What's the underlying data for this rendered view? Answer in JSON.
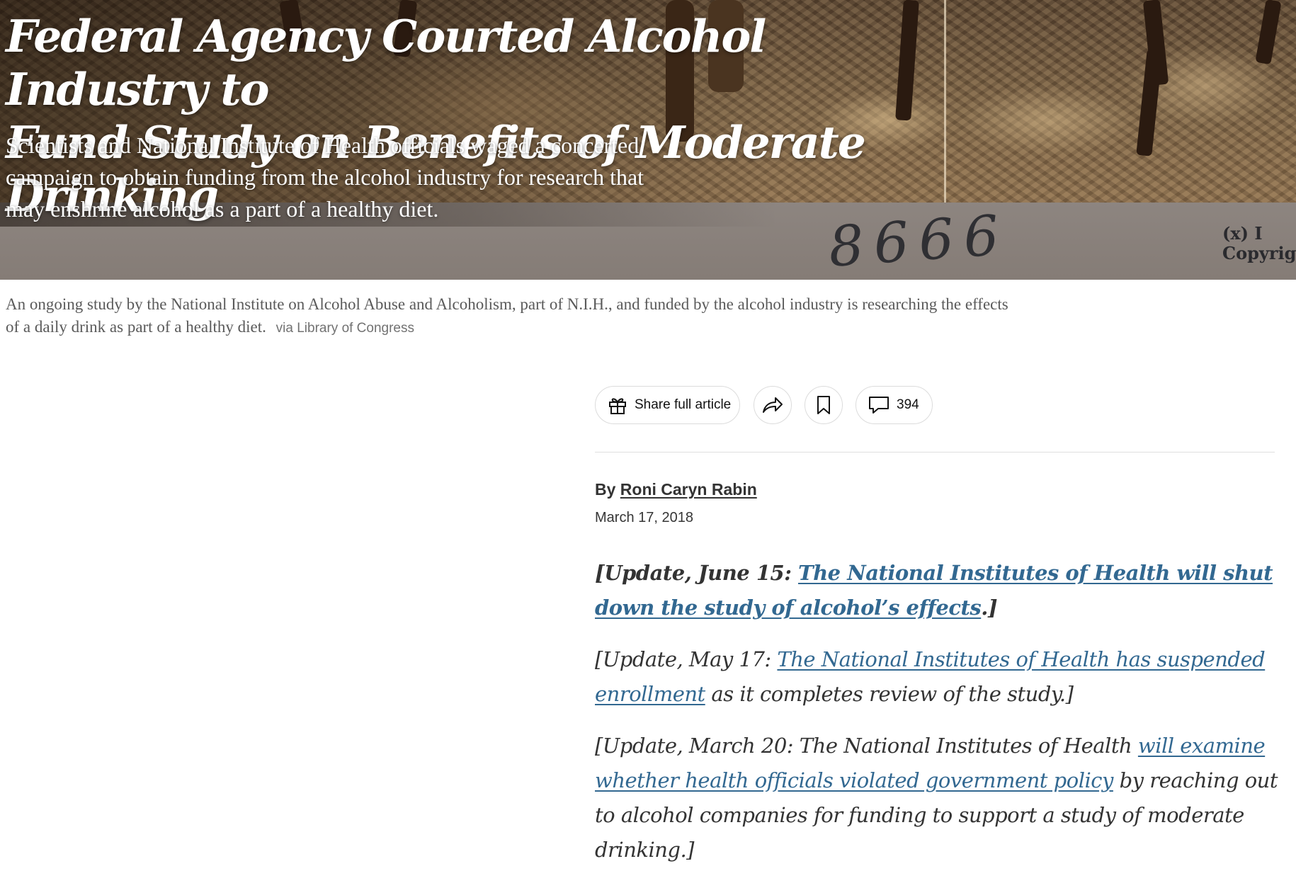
{
  "article": {
    "headline_line1": "Federal Agency Courted Alcohol Industry to",
    "headline_line2": "Fund Study on Benefits of Moderate Drinking",
    "summary": "Scientists and National Institute of Health officials waged a concerted campaign to obtain funding from the alcohol industry for research that may enshrine alcohol as a part of a healthy diet."
  },
  "hero_image": {
    "photo_number": "8666",
    "corner_mark_line1": "(x) I",
    "corner_mark_line2": "Copyrigh"
  },
  "caption": {
    "text": "An ongoing study by the National Institute on Alcohol Abuse and Alcoholism, part of N.I.H., and funded by the alcohol industry is researching the effects of a daily drink as part of a healthy diet.",
    "credit": "via Library of Congress"
  },
  "toolbar": {
    "share_label": "Share full article",
    "share_icon": "gift-icon",
    "forward_icon": "share-arrow-icon",
    "save_icon": "bookmark-icon",
    "comments_icon": "comment-bubble-icon",
    "comments_count": "394"
  },
  "byline": {
    "prefix": "By",
    "author": "Roni Caryn Rabin",
    "date": "March 17, 2018"
  },
  "updates": [
    {
      "prefix": "[Update, June 15: ",
      "link": "The National Institutes of Health will shut down the study of alcohol’s effects",
      "suffix": ".]"
    },
    {
      "prefix": "[Update, May 17: ",
      "link": "The National Institutes of Health has suspended enrollment",
      "suffix": " as it completes review of the study.]"
    },
    {
      "prefix": "[Update, March 20: The National Institutes of Health ",
      "link": "will examine whether health officials violated government policy",
      "suffix": " by reaching out to alcohol companies for funding to support a study of moderate drinking.]"
    }
  ],
  "colors": {
    "link": "#326891",
    "text": "#333333",
    "caption": "#5a5a5a"
  }
}
